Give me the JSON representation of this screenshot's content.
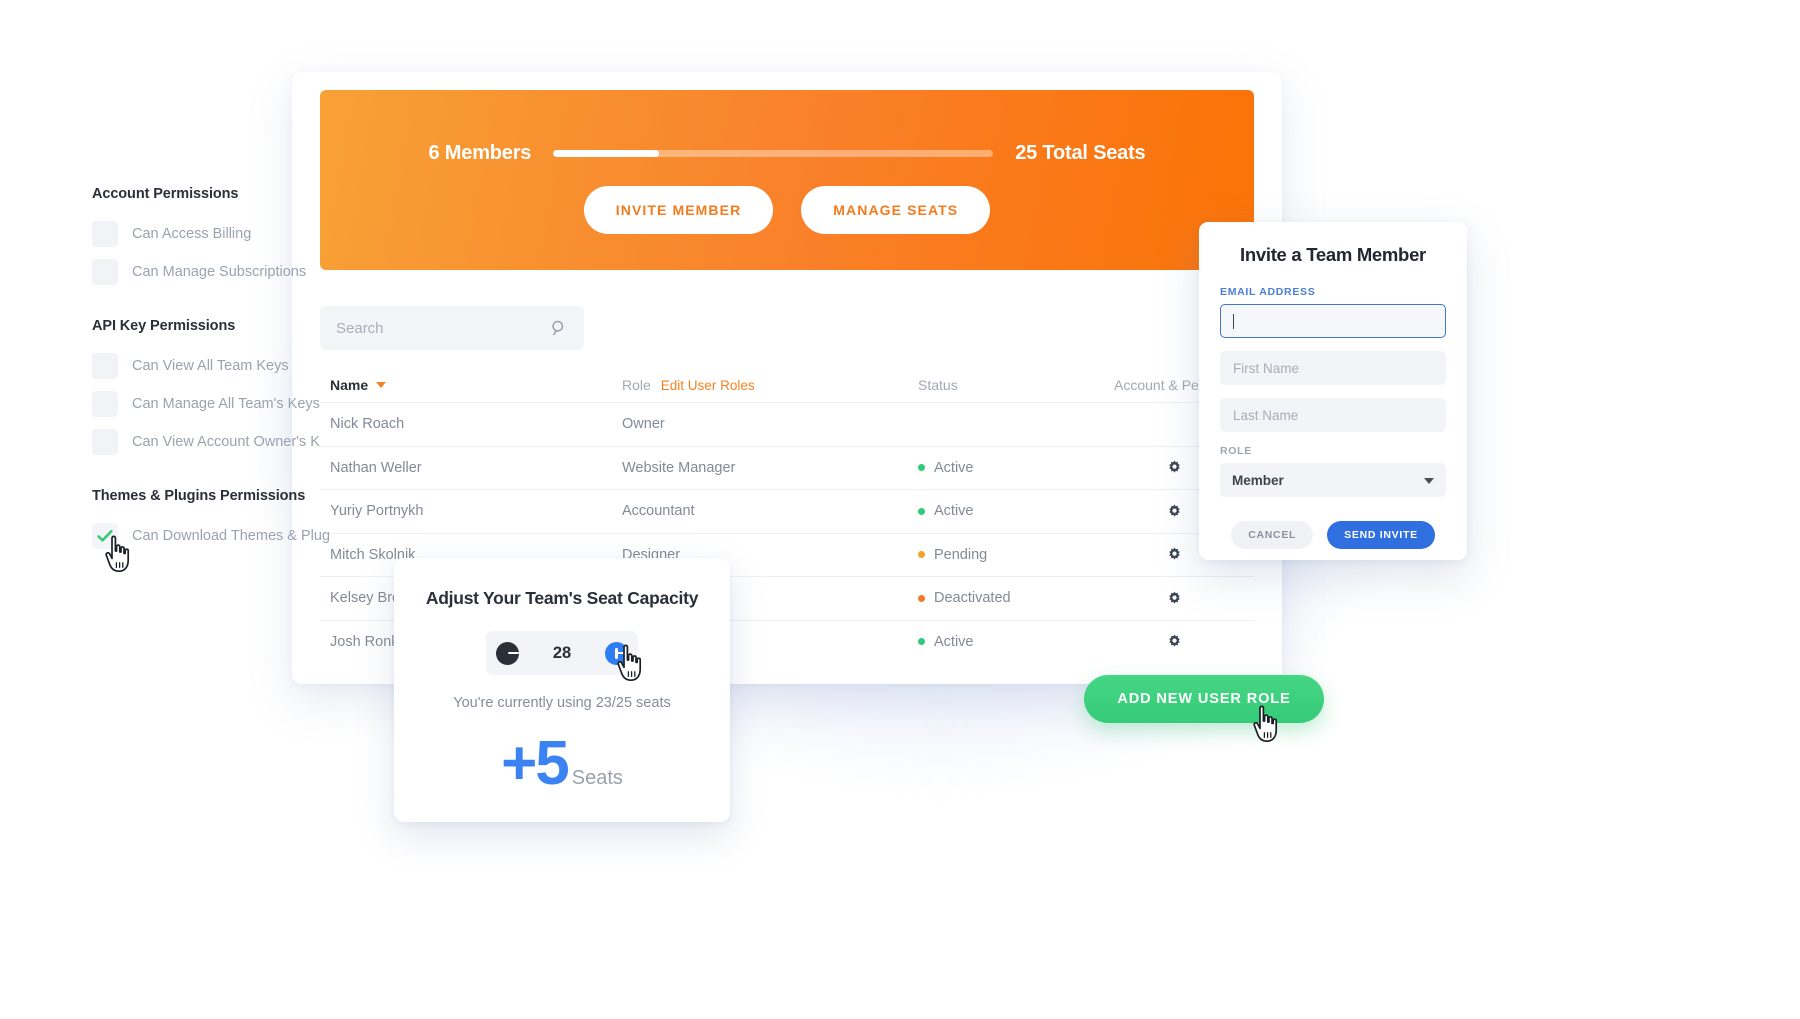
{
  "permissions": {
    "groups": [
      {
        "title": "Account Permissions",
        "items": [
          {
            "label": "Can Access Billing",
            "checked": false
          },
          {
            "label": "Can Manage Subscriptions",
            "checked": false
          }
        ]
      },
      {
        "title": "API Key Permissions",
        "items": [
          {
            "label": "Can View All Team Keys",
            "checked": false
          },
          {
            "label": "Can Manage All Team's Keys",
            "checked": false
          },
          {
            "label": "Can View Account Owner's K",
            "checked": false
          }
        ]
      },
      {
        "title": "Themes & Plugins Permissions",
        "items": [
          {
            "label": "Can Download Themes & Plug",
            "checked": true
          }
        ]
      }
    ],
    "check_color": "#3bc97a"
  },
  "hero": {
    "members_label": "6 Members",
    "total_seats_label": "25 Total Seats",
    "progress_percent": 24,
    "invite_button": "INVITE MEMBER",
    "manage_button": "MANAGE SEATS",
    "gradient_from": "#f8a136",
    "gradient_to": "#fb7307"
  },
  "search": {
    "placeholder": "Search",
    "value": "",
    "icon": "search-icon"
  },
  "table": {
    "columns": {
      "name": "Name",
      "role": "Role",
      "edit_roles_link": "Edit User Roles",
      "status": "Status",
      "account": "Account & Perm"
    },
    "sort_icon": "caret-down-icon",
    "rows": [
      {
        "name": "Nick Roach",
        "role": "Owner",
        "status": "",
        "status_color": "",
        "gear": false
      },
      {
        "name": "Nathan Weller",
        "role": "Website Manager",
        "status": "Active",
        "status_color": "#2ecb7a",
        "gear": true
      },
      {
        "name": "Yuriy Portnykh",
        "role": "Accountant",
        "status": "Active",
        "status_color": "#2ecb7a",
        "gear": true
      },
      {
        "name": "Mitch Skolnik",
        "role": "Designer",
        "status": "Pending",
        "status_color": "#f0a32a",
        "gear": true
      },
      {
        "name": "Kelsey Bro",
        "role": "",
        "status": "Deactivated",
        "status_color": "#f4792a",
        "gear": true
      },
      {
        "name": "Josh Ronk",
        "role": "",
        "status": "Active",
        "status_color": "#2ecb7a",
        "gear": true
      }
    ]
  },
  "seat_card": {
    "title": "Adjust Your Team's Seat Capacity",
    "decrement_icon": "minus-circle-icon",
    "increment_icon": "plus-circle-icon",
    "value": "28",
    "note": "You're currently using 23/25 seats",
    "delta": "+5",
    "delta_unit": "Seats",
    "delta_color": "#3b82f2"
  },
  "invite_modal": {
    "title": "Invite a Team Member",
    "email_label": "EMAIL ADDRESS",
    "email_value": "",
    "email_placeholder": "",
    "first_name_placeholder": "First Name",
    "first_name_value": "",
    "last_name_placeholder": "Last Name",
    "last_name_value": "",
    "role_label": "ROLE",
    "role_value": "Member",
    "role_caret_icon": "chevron-down-icon",
    "cancel_button": "CANCEL",
    "send_button": "SEND INVITE",
    "accent_color": "#2f6fe0"
  },
  "add_role_button": {
    "label": "ADD NEW USER ROLE",
    "color": "#35cb78"
  },
  "cursors": [
    {
      "name": "pointer-hand-permissions"
    },
    {
      "name": "pointer-hand-increment"
    },
    {
      "name": "pointer-hand-add-role"
    }
  ]
}
